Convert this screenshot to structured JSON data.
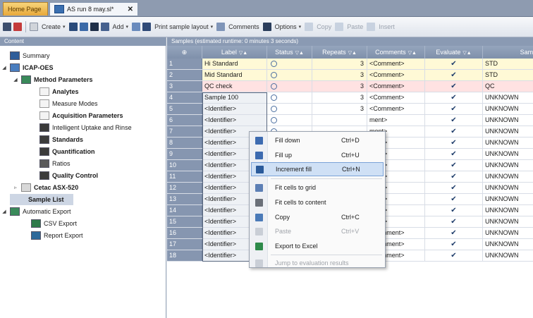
{
  "tabs": [
    {
      "label": "Home Page"
    },
    {
      "label": "AS run 8 may.sl*"
    }
  ],
  "toolbar": {
    "create": "Create",
    "add": "Add",
    "print": "Print sample layout",
    "comments": "Comments",
    "options": "Options",
    "copy": "Copy",
    "paste": "Paste",
    "insert": "Insert"
  },
  "left_pane": {
    "title": "Content",
    "items": [
      {
        "label": "Summary"
      },
      {
        "label": "ICAP-OES"
      },
      {
        "label": "Method Parameters"
      },
      {
        "label": "Analytes"
      },
      {
        "label": "Measure Modes"
      },
      {
        "label": "Acquisition Parameters"
      },
      {
        "label": "Intelligent Uptake and Rinse"
      },
      {
        "label": "Standards"
      },
      {
        "label": "Quantification"
      },
      {
        "label": "Ratios"
      },
      {
        "label": "Quality Control"
      },
      {
        "label": "Cetac ASX-520"
      },
      {
        "label": "Sample List"
      },
      {
        "label": "Automatic Export"
      },
      {
        "label": "CSV Export"
      },
      {
        "label": "Report Export"
      }
    ]
  },
  "grid": {
    "title": "Samples (estimated runtime: 0 minutes 3 seconds)",
    "columns": [
      "Label",
      "Status",
      "Repeats",
      "Comments",
      "Evaluate",
      "Sample Type"
    ],
    "rows": [
      {
        "num": "1",
        "label": "Hi Standard",
        "repeats": "3",
        "comment": "<Comment>",
        "type": "STD",
        "color": "yellow"
      },
      {
        "num": "2",
        "label": "Mid Standard",
        "repeats": "3",
        "comment": "<Comment>",
        "type": "STD",
        "color": "yellow"
      },
      {
        "num": "3",
        "label": "QC check",
        "repeats": "3",
        "comment": "<Comment>",
        "type": "QC",
        "color": "pink"
      },
      {
        "num": "4",
        "label": "Sample 100",
        "repeats": "3",
        "comment": "<Comment>",
        "type": "UNKNOWN",
        "color": ""
      },
      {
        "num": "5",
        "label": "<Identifier>",
        "repeats": "3",
        "comment": "<Comment>",
        "type": "UNKNOWN",
        "color": ""
      },
      {
        "num": "6",
        "label": "<Identifier>",
        "repeats": "",
        "comment": "ment>",
        "type": "UNKNOWN",
        "color": ""
      },
      {
        "num": "7",
        "label": "<Identifier>",
        "repeats": "",
        "comment": "ment>",
        "type": "UNKNOWN",
        "color": ""
      },
      {
        "num": "8",
        "label": "<Identifier>",
        "repeats": "",
        "comment": "ment>",
        "type": "UNKNOWN",
        "color": ""
      },
      {
        "num": "9",
        "label": "<Identifier>",
        "repeats": "",
        "comment": "ment>",
        "type": "UNKNOWN",
        "color": ""
      },
      {
        "num": "10",
        "label": "<Identifier>",
        "repeats": "",
        "comment": "ment>",
        "type": "UNKNOWN",
        "color": ""
      },
      {
        "num": "11",
        "label": "<Identifier>",
        "repeats": "",
        "comment": "ment>",
        "type": "UNKNOWN",
        "color": ""
      },
      {
        "num": "12",
        "label": "<Identifier>",
        "repeats": "",
        "comment": "ment>",
        "type": "UNKNOWN",
        "color": ""
      },
      {
        "num": "13",
        "label": "<Identifier>",
        "repeats": "",
        "comment": "ment>",
        "type": "UNKNOWN",
        "color": ""
      },
      {
        "num": "14",
        "label": "<Identifier>",
        "repeats": "",
        "comment": "ment>",
        "type": "UNKNOWN",
        "color": ""
      },
      {
        "num": "15",
        "label": "<Identifier>",
        "repeats": "",
        "comment": "ment>",
        "type": "UNKNOWN",
        "color": ""
      },
      {
        "num": "16",
        "label": "<Identifier>",
        "repeats": "3",
        "comment": "<Comment>",
        "type": "UNKNOWN",
        "color": ""
      },
      {
        "num": "17",
        "label": "<Identifier>",
        "repeats": "3",
        "comment": "<Comment>",
        "type": "UNKNOWN",
        "color": ""
      },
      {
        "num": "18",
        "label": "<Identifier>",
        "repeats": "3",
        "comment": "<Comment>",
        "type": "UNKNOWN",
        "color": ""
      }
    ]
  },
  "context_menu": {
    "items": [
      {
        "label": "Fill down",
        "shortcut": "Ctrl+D",
        "icon": "fill-down-icon"
      },
      {
        "label": "Fill up",
        "shortcut": "Ctrl+U",
        "icon": "fill-up-icon"
      },
      {
        "label": "Increment fill",
        "shortcut": "Ctrl+N",
        "icon": "increment-fill-icon"
      },
      {
        "label": "Fit cells to grid",
        "shortcut": "",
        "icon": "fit-grid-icon"
      },
      {
        "label": "Fit cells to content",
        "shortcut": "",
        "icon": "fit-content-icon"
      },
      {
        "label": "Copy",
        "shortcut": "Ctrl+C",
        "icon": "copy-icon"
      },
      {
        "label": "Paste",
        "shortcut": "Ctrl+V",
        "icon": "paste-icon"
      },
      {
        "label": "Export to Excel",
        "shortcut": "",
        "icon": "excel-icon"
      },
      {
        "label": "Jump to evaluation results",
        "shortcut": "",
        "icon": "jump-icon"
      }
    ]
  }
}
